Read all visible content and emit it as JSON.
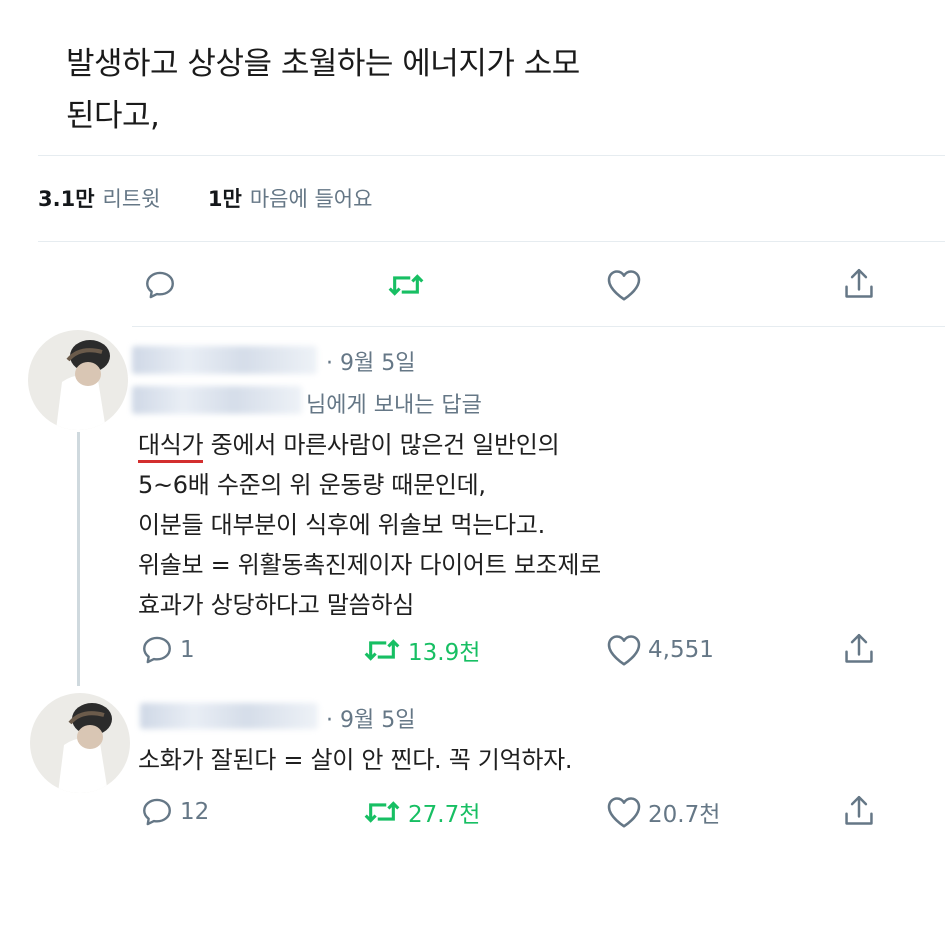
{
  "tweet": {
    "text_lines": [
      "발생하고 상상을 초월하는 에너지가 소모",
      "된다고,"
    ],
    "retweets": {
      "count": "3.1만",
      "label": "리트윗"
    },
    "likes": {
      "count": "1만",
      "label": "마음에 들어요"
    }
  },
  "replies": [
    {
      "date": "· 9월 5일",
      "reply_to_suffix": "님에게 보내는 답글",
      "text_first_highlight": "대식가",
      "text_first_rest": " 중에서 마른사람이 많은건 일반인의",
      "text_lines": [
        "5~6배 수준의 위 운동량 때문인데,",
        "이분들 대부분이 식후에 위솔보 먹는다고.",
        "위솔보 = 위활동촉진제이자 다이어트 보조제로",
        "효과가 상당하다고 말씀하심"
      ],
      "reply_count": "1",
      "retweet_count": "13.9천",
      "like_count": "4,551"
    },
    {
      "date": "· 9월 5일",
      "text": "소화가 잘된다 = 살이 안 찐다. 꼭 기억하자.",
      "reply_count": "12",
      "retweet_count": "27.7천",
      "like_count": "20.7천"
    }
  ],
  "colors": {
    "retweet": "#17bf63",
    "muted": "#657786",
    "underline": "#d32f2f"
  },
  "icons": [
    "reply-icon",
    "retweet-icon",
    "like-icon",
    "share-icon"
  ]
}
